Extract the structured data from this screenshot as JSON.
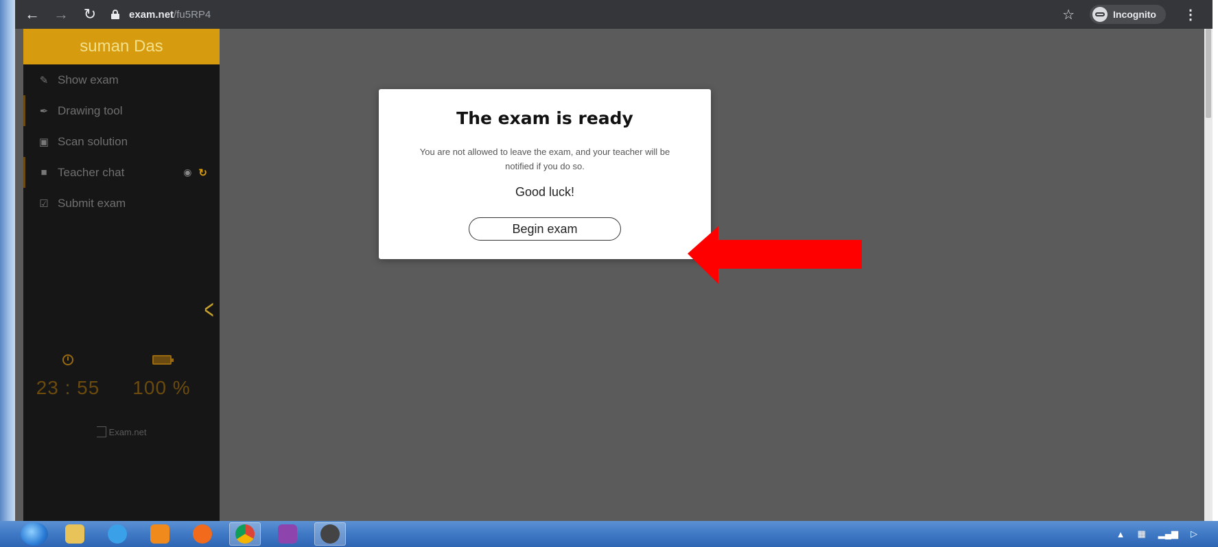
{
  "browser": {
    "url_host": "exam.net",
    "url_path": "/fu5RP4",
    "incognito_label": "Incognito",
    "back_icon": "back-arrow-icon",
    "forward_icon": "forward-arrow-icon",
    "reload_icon": "reload-icon"
  },
  "sidebar": {
    "user_name": "suman Das",
    "items": [
      {
        "label": "Show exam",
        "icon": "edit-icon"
      },
      {
        "label": "Drawing tool",
        "icon": "brush-icon"
      },
      {
        "label": "Scan solution",
        "icon": "camera-icon"
      },
      {
        "label": "Teacher chat",
        "icon": "chat-icon"
      },
      {
        "label": "Submit exam",
        "icon": "checkbox-icon"
      }
    ],
    "time_left": "23 : 55",
    "battery": "100 %",
    "brand": "Exam.net",
    "accent_color": "#d79b10"
  },
  "modal": {
    "title": "The exam is ready",
    "body": "You are not allowed to leave the exam, and your teacher will be notified if you do so.",
    "luck": "Good luck!",
    "button": "Begin exam"
  },
  "annotation": {
    "arrow_color": "#ff0000"
  }
}
